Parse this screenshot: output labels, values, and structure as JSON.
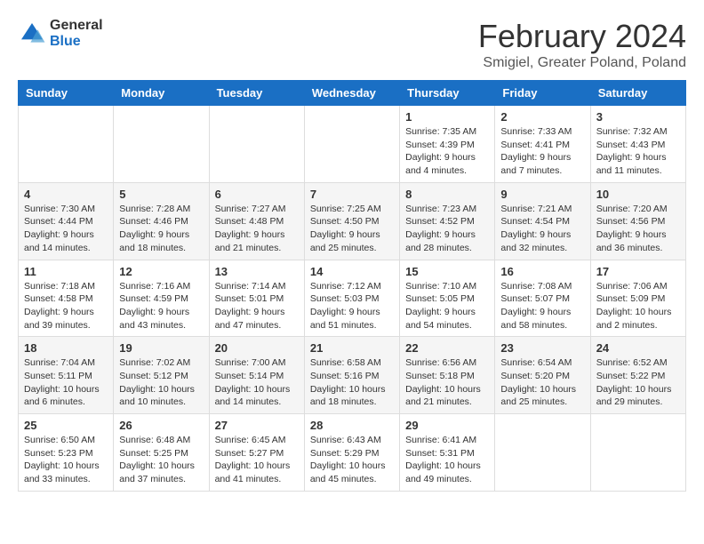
{
  "logo": {
    "line1": "General",
    "line2": "Blue"
  },
  "title": "February 2024",
  "subtitle": "Smigiel, Greater Poland, Poland",
  "headers": [
    "Sunday",
    "Monday",
    "Tuesday",
    "Wednesday",
    "Thursday",
    "Friday",
    "Saturday"
  ],
  "rows": [
    [
      {
        "day": "",
        "info": ""
      },
      {
        "day": "",
        "info": ""
      },
      {
        "day": "",
        "info": ""
      },
      {
        "day": "",
        "info": ""
      },
      {
        "day": "1",
        "info": "Sunrise: 7:35 AM\nSunset: 4:39 PM\nDaylight: 9 hours and 4 minutes."
      },
      {
        "day": "2",
        "info": "Sunrise: 7:33 AM\nSunset: 4:41 PM\nDaylight: 9 hours and 7 minutes."
      },
      {
        "day": "3",
        "info": "Sunrise: 7:32 AM\nSunset: 4:43 PM\nDaylight: 9 hours and 11 minutes."
      }
    ],
    [
      {
        "day": "4",
        "info": "Sunrise: 7:30 AM\nSunset: 4:44 PM\nDaylight: 9 hours and 14 minutes."
      },
      {
        "day": "5",
        "info": "Sunrise: 7:28 AM\nSunset: 4:46 PM\nDaylight: 9 hours and 18 minutes."
      },
      {
        "day": "6",
        "info": "Sunrise: 7:27 AM\nSunset: 4:48 PM\nDaylight: 9 hours and 21 minutes."
      },
      {
        "day": "7",
        "info": "Sunrise: 7:25 AM\nSunset: 4:50 PM\nDaylight: 9 hours and 25 minutes."
      },
      {
        "day": "8",
        "info": "Sunrise: 7:23 AM\nSunset: 4:52 PM\nDaylight: 9 hours and 28 minutes."
      },
      {
        "day": "9",
        "info": "Sunrise: 7:21 AM\nSunset: 4:54 PM\nDaylight: 9 hours and 32 minutes."
      },
      {
        "day": "10",
        "info": "Sunrise: 7:20 AM\nSunset: 4:56 PM\nDaylight: 9 hours and 36 minutes."
      }
    ],
    [
      {
        "day": "11",
        "info": "Sunrise: 7:18 AM\nSunset: 4:58 PM\nDaylight: 9 hours and 39 minutes."
      },
      {
        "day": "12",
        "info": "Sunrise: 7:16 AM\nSunset: 4:59 PM\nDaylight: 9 hours and 43 minutes."
      },
      {
        "day": "13",
        "info": "Sunrise: 7:14 AM\nSunset: 5:01 PM\nDaylight: 9 hours and 47 minutes."
      },
      {
        "day": "14",
        "info": "Sunrise: 7:12 AM\nSunset: 5:03 PM\nDaylight: 9 hours and 51 minutes."
      },
      {
        "day": "15",
        "info": "Sunrise: 7:10 AM\nSunset: 5:05 PM\nDaylight: 9 hours and 54 minutes."
      },
      {
        "day": "16",
        "info": "Sunrise: 7:08 AM\nSunset: 5:07 PM\nDaylight: 9 hours and 58 minutes."
      },
      {
        "day": "17",
        "info": "Sunrise: 7:06 AM\nSunset: 5:09 PM\nDaylight: 10 hours and 2 minutes."
      }
    ],
    [
      {
        "day": "18",
        "info": "Sunrise: 7:04 AM\nSunset: 5:11 PM\nDaylight: 10 hours and 6 minutes."
      },
      {
        "day": "19",
        "info": "Sunrise: 7:02 AM\nSunset: 5:12 PM\nDaylight: 10 hours and 10 minutes."
      },
      {
        "day": "20",
        "info": "Sunrise: 7:00 AM\nSunset: 5:14 PM\nDaylight: 10 hours and 14 minutes."
      },
      {
        "day": "21",
        "info": "Sunrise: 6:58 AM\nSunset: 5:16 PM\nDaylight: 10 hours and 18 minutes."
      },
      {
        "day": "22",
        "info": "Sunrise: 6:56 AM\nSunset: 5:18 PM\nDaylight: 10 hours and 21 minutes."
      },
      {
        "day": "23",
        "info": "Sunrise: 6:54 AM\nSunset: 5:20 PM\nDaylight: 10 hours and 25 minutes."
      },
      {
        "day": "24",
        "info": "Sunrise: 6:52 AM\nSunset: 5:22 PM\nDaylight: 10 hours and 29 minutes."
      }
    ],
    [
      {
        "day": "25",
        "info": "Sunrise: 6:50 AM\nSunset: 5:23 PM\nDaylight: 10 hours and 33 minutes."
      },
      {
        "day": "26",
        "info": "Sunrise: 6:48 AM\nSunset: 5:25 PM\nDaylight: 10 hours and 37 minutes."
      },
      {
        "day": "27",
        "info": "Sunrise: 6:45 AM\nSunset: 5:27 PM\nDaylight: 10 hours and 41 minutes."
      },
      {
        "day": "28",
        "info": "Sunrise: 6:43 AM\nSunset: 5:29 PM\nDaylight: 10 hours and 45 minutes."
      },
      {
        "day": "29",
        "info": "Sunrise: 6:41 AM\nSunset: 5:31 PM\nDaylight: 10 hours and 49 minutes."
      },
      {
        "day": "",
        "info": ""
      },
      {
        "day": "",
        "info": ""
      }
    ]
  ]
}
